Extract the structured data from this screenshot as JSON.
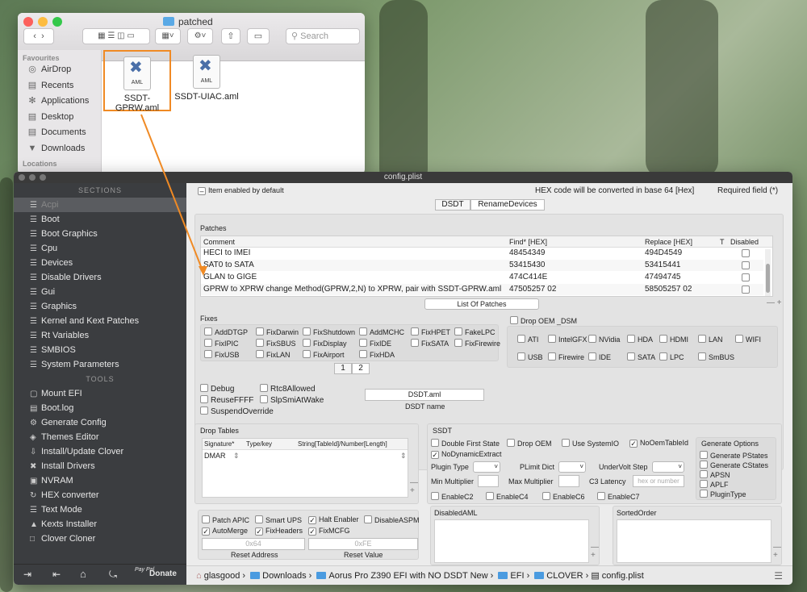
{
  "finder": {
    "title": "patched",
    "search_placeholder": "Search",
    "sidebar_header": "Favourites",
    "sidebar_items": [
      {
        "label": "AirDrop",
        "icon": "airdrop-icon"
      },
      {
        "label": "Recents",
        "icon": "recents-icon"
      },
      {
        "label": "Applications",
        "icon": "applications-icon"
      },
      {
        "label": "Desktop",
        "icon": "desktop-icon"
      },
      {
        "label": "Documents",
        "icon": "documents-icon"
      },
      {
        "label": "Downloads",
        "icon": "downloads-icon"
      }
    ],
    "sidebar_header2": "Locations",
    "files": [
      {
        "name": "SSDT-GPRW.aml",
        "badge": "AML",
        "selected": true
      },
      {
        "name": "SSDT-UIAC.aml",
        "badge": "AML",
        "selected": false
      }
    ],
    "highlight_color": "#f08a24"
  },
  "clover": {
    "title": "config.plist",
    "sidebar_header": "SECTIONS",
    "sections": [
      "Acpi",
      "Boot",
      "Boot Graphics",
      "Cpu",
      "Devices",
      "Disable Drivers",
      "Gui",
      "Graphics",
      "Kernel and Kext Patches",
      "Rt Variables",
      "SMBIOS",
      "System Parameters"
    ],
    "tools_header": "TOOLS",
    "tools": [
      {
        "label": "Mount EFI",
        "icon": "disk-icon"
      },
      {
        "label": "Boot.log",
        "icon": "log-icon"
      },
      {
        "label": "Generate Config",
        "icon": "gear-icon"
      },
      {
        "label": "Themes Editor",
        "icon": "palette-icon"
      },
      {
        "label": "Install/Update Clover",
        "icon": "download-icon"
      },
      {
        "label": "Install Drivers",
        "icon": "tools-icon"
      },
      {
        "label": "NVRAM",
        "icon": "chip-icon"
      },
      {
        "label": "HEX converter",
        "icon": "refresh-icon"
      },
      {
        "label": "Text Mode",
        "icon": "text-icon"
      },
      {
        "label": "Kexts Installer",
        "icon": "kext-icon"
      },
      {
        "label": "Clover Cloner",
        "icon": "clone-icon"
      }
    ],
    "donate_label": "Donate",
    "paypal_label": "Pay Pal",
    "header": {
      "item_enabled": "Item enabled by default",
      "hex_note": "HEX code will be converted in base 64 [Hex]",
      "required": "Required field (*)"
    },
    "tabs": [
      "DSDT",
      "RenameDevices"
    ],
    "patches": {
      "title": "Patches",
      "columns": [
        "Comment",
        "Find* [HEX]",
        "Replace [HEX]",
        "T",
        "Disabled"
      ],
      "rows": [
        {
          "comment": "HECI to IMEI",
          "find": "48454349",
          "replace": "494D4549"
        },
        {
          "comment": "SAT0 to SATA",
          "find": "53415430",
          "replace": "53415441"
        },
        {
          "comment": "GLAN to GIGE",
          "find": "474C414E",
          "replace": "47494745"
        },
        {
          "comment": "GPRW to XPRW change Method(GPRW,2,N) to XPRW, pair with SSDT-GPRW.aml",
          "find": "47505257 02",
          "replace": "58505257 02"
        }
      ],
      "list_button": "List Of Patches",
      "minus_plus": "— +"
    },
    "fixes": {
      "title": "Fixes",
      "items": [
        [
          "AddDTGP",
          "FixDarwin",
          "FixShutdown",
          "AddMCHC",
          "FixHPET",
          "FakeLPC"
        ],
        [
          "FixIPIC",
          "FixSBUS",
          "FixDisplay",
          "FixIDE",
          "FixSATA",
          "FixFirewire"
        ],
        [
          "FixUSB",
          "FixLAN",
          "FixAirport",
          "FixHDA"
        ]
      ],
      "pages": [
        "1",
        "2"
      ]
    },
    "drop_oem": {
      "label": "Drop OEM _DSM",
      "row1": [
        "ATI",
        "IntelGFX",
        "NVidia",
        "HDA",
        "HDMI",
        "LAN",
        "WIFI"
      ],
      "row2": [
        "USB",
        "Firewire",
        "IDE",
        "SATA",
        "LPC",
        "SmBUS"
      ]
    },
    "flags": {
      "debug": "Debug",
      "rtc": "Rtc8Allowed",
      "reuse": "ReuseFFFF",
      "slp": "SlpSmiAtWake",
      "suspend": "SuspendOverride"
    },
    "dsdt_name": {
      "value": "DSDT.aml",
      "label": "DSDT name"
    },
    "drop_tables": {
      "title": "Drop Tables",
      "columns": [
        "Signature*",
        "Type/key",
        "String[TableId]/Number[Length]"
      ],
      "row": "DMAR"
    },
    "ssdt": {
      "title": "SSDT",
      "checks": [
        {
          "label": "Double First State",
          "checked": false
        },
        {
          "label": "Drop OEM",
          "checked": false
        },
        {
          "label": "Use SystemIO",
          "checked": false
        },
        {
          "label": "NoOemTableId",
          "checked": true
        },
        {
          "label": "NoDynamicExtract",
          "checked": true
        }
      ],
      "plugin_type": "Plugin Type",
      "plimit": "PLimit Dict",
      "undervolt": "UnderVolt Step",
      "min_mult": "Min Multiplier",
      "max_mult": "Max Multiplier",
      "c3": "C3 Latency",
      "c3_placeholder": "hex or number",
      "enables": [
        "EnableC2",
        "EnableC4",
        "EnableC6",
        "EnableC7"
      ],
      "gen_title": "Generate Options",
      "gen_items": [
        "Generate PStates",
        "Generate CStates",
        "APSN",
        "APLF",
        "PluginType"
      ]
    },
    "misc": {
      "checks": [
        {
          "label": "Patch APIC",
          "checked": false
        },
        {
          "label": "Smart UPS",
          "checked": false
        },
        {
          "label": "Halt Enabler",
          "checked": true
        },
        {
          "label": "DisableASPM",
          "checked": false
        },
        {
          "label": "AutoMerge",
          "checked": true
        },
        {
          "label": "FixHeaders",
          "checked": true
        },
        {
          "label": "FixMCFG",
          "checked": true
        }
      ],
      "reset_addr_value": "0x64",
      "reset_addr_label": "Reset Address",
      "reset_val_value": "0xFE",
      "reset_val_label": "Reset Value"
    },
    "disabled_aml": "DisabledAML",
    "sorted_order": "SortedOrder",
    "pathbar": [
      "glasgood",
      "Downloads",
      "Aorus Pro Z390 EFI with NO DSDT New",
      "EFI",
      "CLOVER",
      "config.plist"
    ]
  }
}
